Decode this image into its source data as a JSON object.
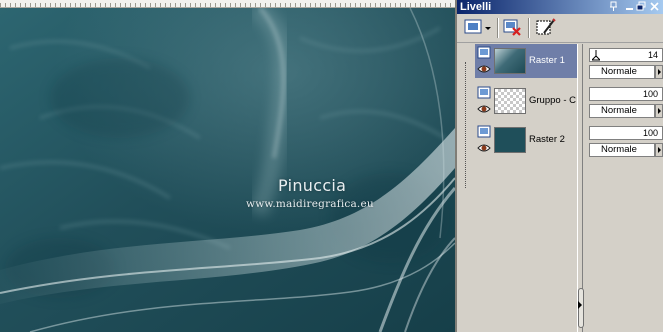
{
  "canvas": {
    "watermark_title": "Pinuccia",
    "watermark_url": "www.maidiregrafica.eu"
  },
  "palette": {
    "title": "Livelli",
    "titlebar_buttons": {
      "pin": "☵",
      "close": "✕"
    },
    "toolbar": {
      "new_layer_icon": "new-layer-icon",
      "delete_icon": "delete-layer-icon",
      "properties_icon": "layer-properties-icon"
    },
    "layers": [
      {
        "name": "Raster 1",
        "selected": true,
        "visible": true,
        "opacity": 14,
        "opacity_display": "14",
        "blend": "Normale",
        "thumb": "image"
      },
      {
        "name": "Gruppo - C",
        "selected": false,
        "visible": true,
        "opacity": 100,
        "opacity_display": "100",
        "blend": "Normale",
        "thumb": "transparent"
      },
      {
        "name": "Raster 2",
        "selected": false,
        "visible": true,
        "opacity": 100,
        "opacity_display": "100",
        "blend": "Normale",
        "thumb": "teal"
      }
    ]
  },
  "colors": {
    "canvas_base": "#1f5560",
    "titlebar_start": "#0a246a",
    "titlebar_end": "#a6caf0",
    "selection": "#6f7ea8",
    "window_face": "#d4d0c8"
  }
}
